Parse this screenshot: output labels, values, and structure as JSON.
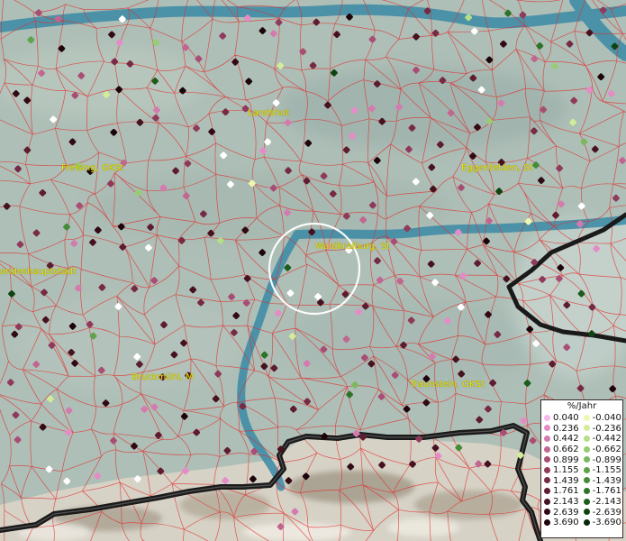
{
  "towns": [
    {
      "id": "landshut",
      "label": "Landshut"
    },
    {
      "id": "freising",
      "label": "Freising, GKSt"
    },
    {
      "id": "eggenfelden",
      "label": "Eggenfelden, St"
    },
    {
      "id": "waldkraiburg",
      "label": "Waldkraiburg, St"
    },
    {
      "id": "landeshauptstadt",
      "label": "andeshauptstadt"
    },
    {
      "id": "bruckmuehl",
      "label": "Bruckmühl, M"
    },
    {
      "id": "traunstein",
      "label": "Traunstein, GKSt"
    }
  ],
  "legend": {
    "unit": "%/Jahr",
    "rows": [
      {
        "pos": "0.040",
        "pos_color": "#f7b8e8",
        "neg": "-0.040",
        "neg_color": "#eef7b0"
      },
      {
        "pos": "0.236",
        "pos_color": "#e58cc8",
        "neg": "-0.236",
        "neg_color": "#d3ec9a"
      },
      {
        "pos": "0.442",
        "pos_color": "#d47aae",
        "neg": "-0.442",
        "neg_color": "#b6dd88"
      },
      {
        "pos": "0.662",
        "pos_color": "#c06690",
        "neg": "-0.662",
        "neg_color": "#98cc72"
      },
      {
        "pos": "0.899",
        "pos_color": "#a84e74",
        "neg": "-0.899",
        "neg_color": "#7cb85e"
      },
      {
        "pos": "1.155",
        "pos_color": "#8f3a5a",
        "neg": "-1.155",
        "neg_color": "#5ea34a"
      },
      {
        "pos": "1.439",
        "pos_color": "#772a44",
        "neg": "-1.439",
        "neg_color": "#448c38"
      },
      {
        "pos": "1.761",
        "pos_color": "#5e1c30",
        "neg": "-1.761",
        "neg_color": "#2d7428"
      },
      {
        "pos": "2.143",
        "pos_color": "#471220",
        "neg": "-2.143",
        "neg_color": "#1c5c1c"
      },
      {
        "pos": "2.639",
        "pos_color": "#310a14",
        "neg": "-2.639",
        "neg_color": "#0f4412"
      },
      {
        "pos": "3.690",
        "pos_color": "#1d040a",
        "neg": "-3.690",
        "neg_color": "#05280a"
      }
    ]
  }
}
